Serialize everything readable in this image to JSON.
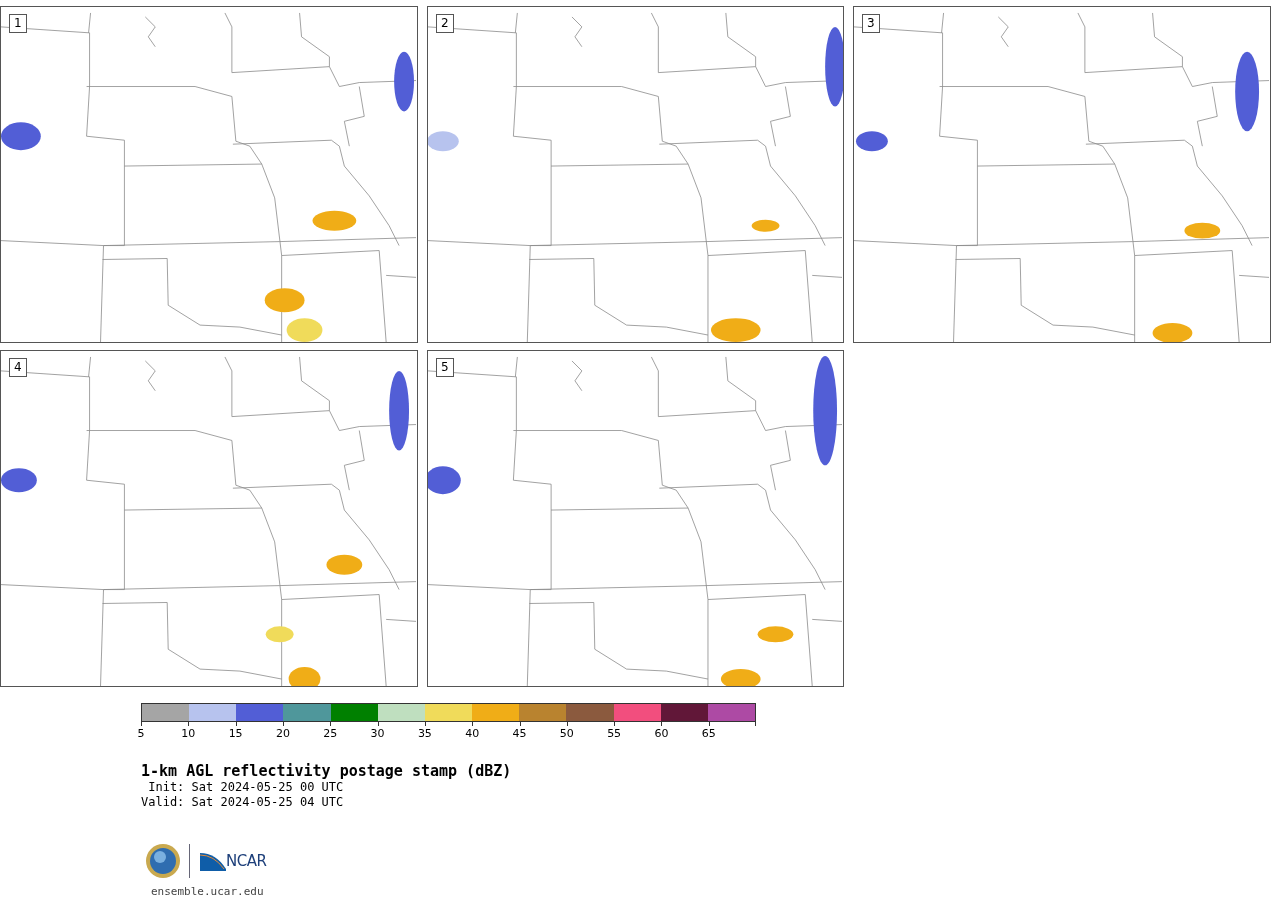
{
  "panels": [
    {
      "number": "1"
    },
    {
      "number": "2"
    },
    {
      "number": "3"
    },
    {
      "number": "4"
    },
    {
      "number": "5"
    }
  ],
  "colorbar": {
    "segments": [
      {
        "label": "5",
        "color": "#a5a5a5"
      },
      {
        "label": "10",
        "color": "#b7c3ee"
      },
      {
        "label": "15",
        "color": "#525ed6"
      },
      {
        "label": "20",
        "color": "#4f979b"
      },
      {
        "label": "25",
        "color": "#008000"
      },
      {
        "label": "30",
        "color": "#bfdfbf"
      },
      {
        "label": "35",
        "color": "#f0db5a"
      },
      {
        "label": "40",
        "color": "#f0ad17"
      },
      {
        "label": "45",
        "color": "#b9832f"
      },
      {
        "label": "50",
        "color": "#8b5a3e"
      },
      {
        "label": "55",
        "color": "#f24e7e"
      },
      {
        "label": "60",
        "color": "#611738"
      },
      {
        "label": "65",
        "color": "#ad4aa4"
      }
    ]
  },
  "title": "1-km AGL reflectivity postage stamp (dBZ)",
  "init": " Init: Sat 2024-05-25 00 UTC",
  "valid": "Valid: Sat 2024-05-25 04 UTC",
  "logo": {
    "text": "NCAR",
    "url": "ensemble.ucar.edu"
  }
}
